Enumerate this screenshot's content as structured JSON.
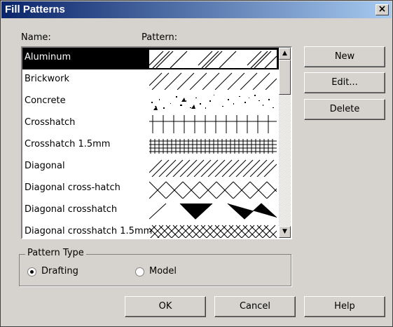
{
  "window": {
    "title": "Fill Patterns",
    "close_glyph": "×"
  },
  "headers": {
    "name": "Name:",
    "pattern": "Pattern:"
  },
  "patterns": [
    {
      "name": "Aluminum",
      "pattern_icon": "aluminum-pattern-icon",
      "selected": true
    },
    {
      "name": "Brickwork",
      "pattern_icon": "brickwork-pattern-icon",
      "selected": false
    },
    {
      "name": "Concrete",
      "pattern_icon": "concrete-pattern-icon",
      "selected": false
    },
    {
      "name": "Crosshatch",
      "pattern_icon": "crosshatch-pattern-icon",
      "selected": false
    },
    {
      "name": "Crosshatch 1.5mm",
      "pattern_icon": "crosshatch-fine-pattern-icon",
      "selected": false
    },
    {
      "name": "Diagonal",
      "pattern_icon": "diagonal-pattern-icon",
      "selected": false
    },
    {
      "name": "Diagonal cross-hatch",
      "pattern_icon": "diagonal-cross-hatch-pattern-icon",
      "selected": false
    },
    {
      "name": "Diagonal crosshatch",
      "pattern_icon": "diagonal-crosshatch-pattern-icon",
      "selected": false
    },
    {
      "name": "Diagonal crosshatch 1.5mm",
      "pattern_icon": "diagonal-crosshatch-fine-pattern-icon",
      "selected": false
    }
  ],
  "side_buttons": {
    "new": "New",
    "edit": "Edit...",
    "delete": "Delete"
  },
  "pattern_type": {
    "label": "Pattern Type",
    "options": [
      {
        "label": "Drafting",
        "checked": true
      },
      {
        "label": "Model",
        "checked": false
      }
    ]
  },
  "bottom_buttons": {
    "ok": "OK",
    "cancel": "Cancel",
    "help": "Help"
  },
  "scrollbar": {
    "up_glyph": "▲",
    "down_glyph": "▼"
  }
}
